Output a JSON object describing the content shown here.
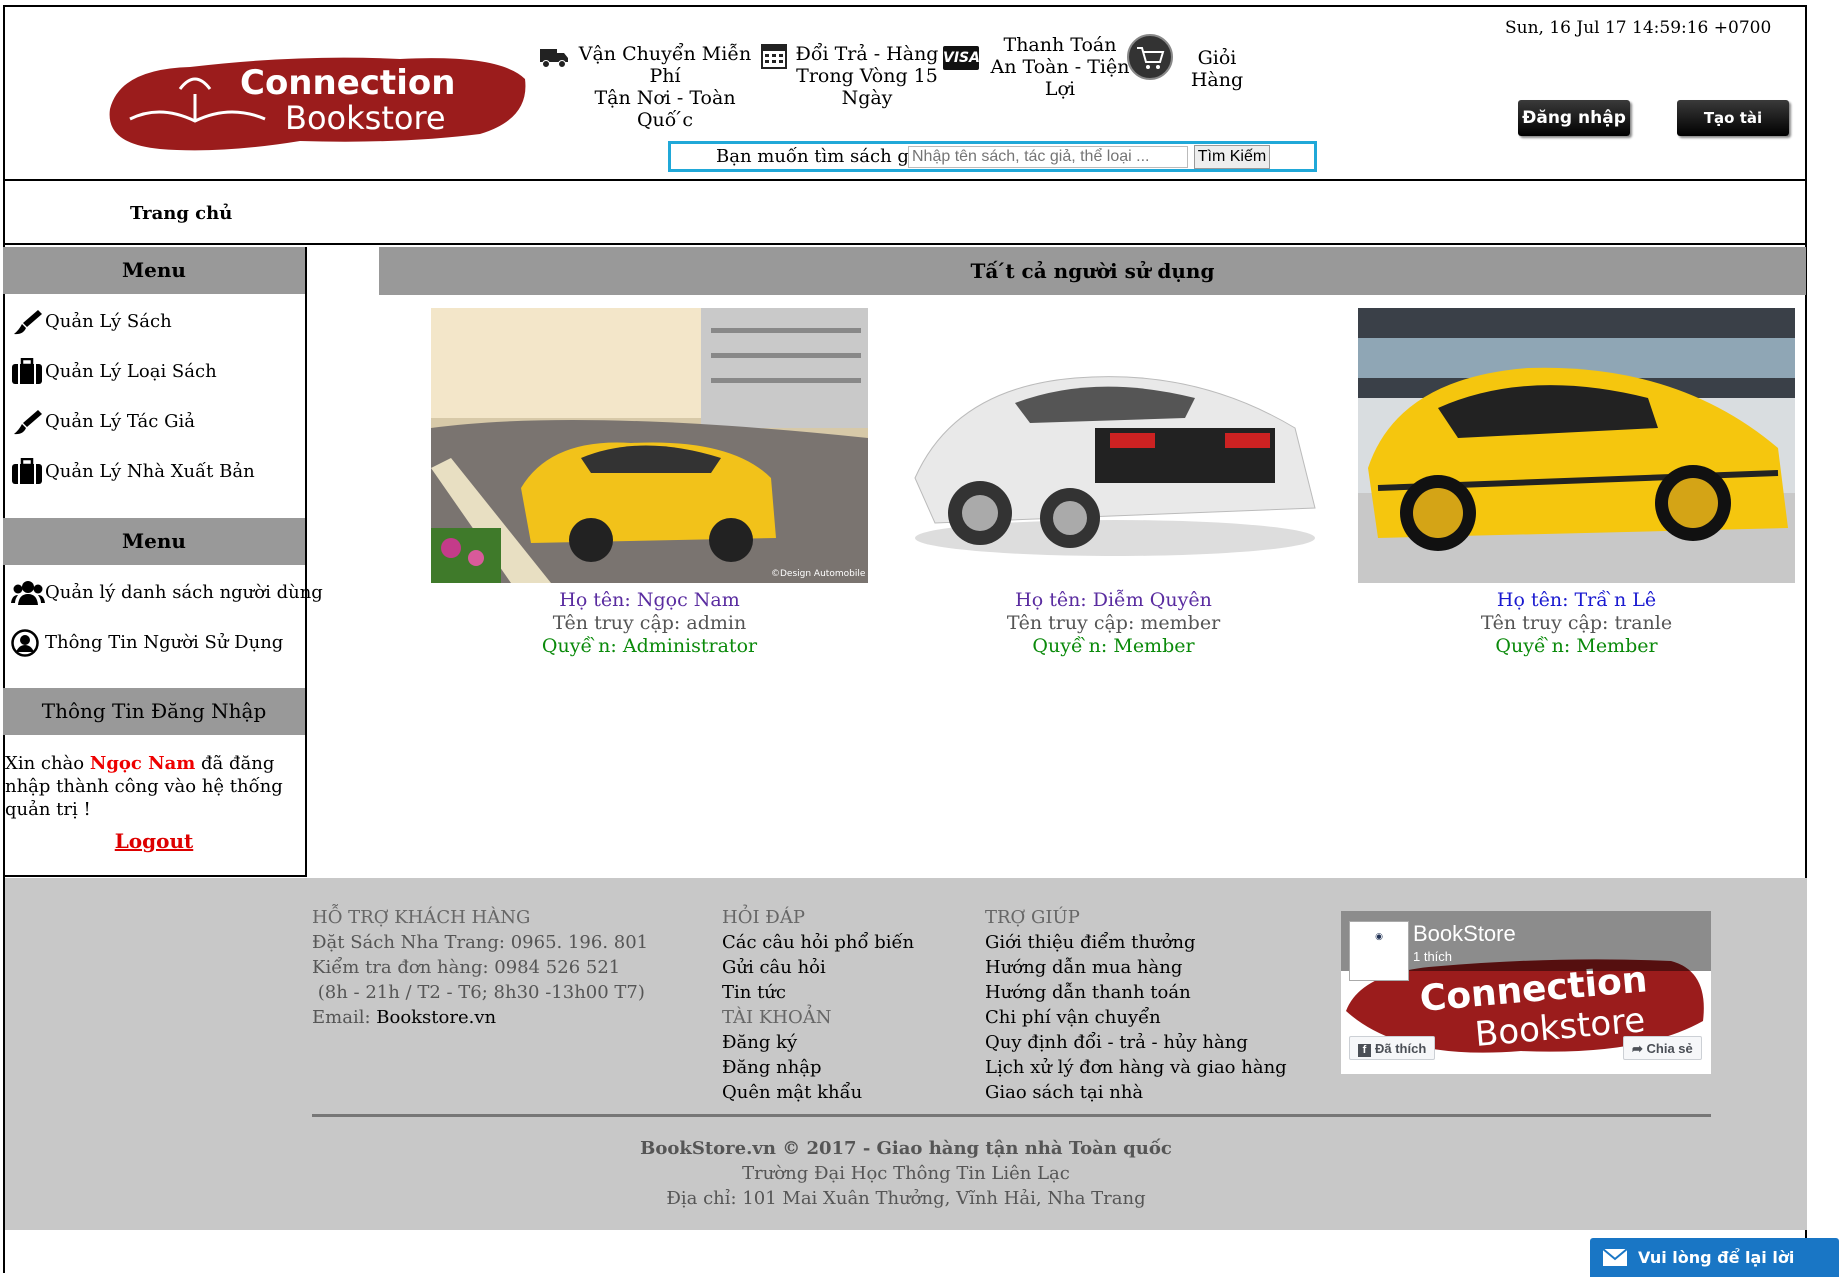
{
  "header": {
    "datetime": "Sun, 16 Jul 17 14:59:16 +0700",
    "logo_text_1": "Connection",
    "logo_text_2": "Bookstore",
    "shipping_1": "Vận Chuyển Miễn Phí",
    "shipping_2": "Tận Nơi - Toàn Quố ́c",
    "return_1": "Đổi Trả - Hàng",
    "return_2": "Trong Vòng 15 Ngày",
    "payment_1": "Thanh Toán",
    "payment_2": "An Toàn - Tiện",
    "payment_3": "Lợi",
    "visa": "VISA",
    "cart": "Giỏi Hàng",
    "login_button": "Đăng nhập",
    "register_button": "Tạo tài khoản"
  },
  "search": {
    "label": "Bạn muốn tìm sách gì?",
    "placeholder": "Nhập tên sách, tác giả, thể loại ...",
    "button": "Tìm Kiếm"
  },
  "nav": {
    "home": "Trang chủ"
  },
  "sidebar": {
    "menu1_title": "Menu",
    "menu1_items": [
      "Quản Lý Sách",
      "Quản Lý Loại Sách",
      "Quản Lý Tác Giả",
      "Quản Lý Nhà Xuất Bản"
    ],
    "menu2_title": "Menu",
    "menu2_items": [
      "Quản lý danh sách người dùng",
      "Thông Tin Người Sử Dụng"
    ],
    "login_info_title": "Thông Tin Đăng Nhập",
    "welcome_prefix": "Xin chào ",
    "welcome_name": "Ngọc Nam",
    "welcome_suffix": " đã đăng nhập thành công vào hệ thống quản trị !",
    "logout": "Logout"
  },
  "main": {
    "title": "Tấ ́t cả người sử dụng",
    "users": [
      {
        "name": "Họ tên: Ngọc Nam",
        "username": "Tên truy cập: admin",
        "role": "Quyề ̀n: Administrator",
        "name_color": "#5a2ca0"
      },
      {
        "name": "Họ tên: Diễm Quyên",
        "username": "Tên truy cập: member",
        "role": "Quyề ̀n: Member",
        "name_color": "#5a2ca0"
      },
      {
        "name": "Họ tên: Trầ ̀n Lê",
        "username": "Tên truy cập: tranle",
        "role": "Quyề ̀n: Member",
        "name_color": "#1a1ad0"
      }
    ],
    "img_credit": "©Design Automobile"
  },
  "footer": {
    "support_title": "HỖ TRỢ KHÁCH HÀNG",
    "support_lines": [
      "Đặt Sách Nha Trang: 0965. 196. 801",
      "Kiểm tra đơn hàng: 0984 526 521",
      " (8h - 21h / T2 - T6; 8h30 -13h00 T7)"
    ],
    "email_label": "Email: ",
    "email_value": "Bookstore.vn",
    "faq_title": "HỎI ĐÁP",
    "faq_items": [
      "Các câu hỏi phổ biến",
      "Gửi câu hỏi",
      "Tin tức"
    ],
    "account_title": "TÀI KHOẢN",
    "account_items": [
      "Đăng ký",
      "Đăng nhập",
      "Quên mật khẩu"
    ],
    "help_title": "TRỢ GIÚP",
    "help_items": [
      "Giới thiệu điểm thưởng",
      "Hướng dẫn mua hàng",
      "Hướng dẫn thanh toán",
      "Chi phí vận chuyển",
      "Quy định đổi - trả - hủy hàng",
      "Lịch xử lý đơn hàng và giao hàng",
      "Giao sách tại nhà"
    ],
    "fb_page": "BookStore",
    "fb_likes": "1 thích",
    "fb_liked": "Đã thích",
    "fb_share": "Chia sẻ",
    "copyright": "BookStore.vn © 2017 - Giao hàng tận nhà Toàn quốc",
    "school": "Trường Đại Học Thông Tin Liên Lạc",
    "address": "Địa chỉ: 101 Mai Xuân Thưởng, Vĩnh Hải, Nha Trang"
  },
  "chat": {
    "label": "Vui lòng để lại lời nhắn"
  }
}
